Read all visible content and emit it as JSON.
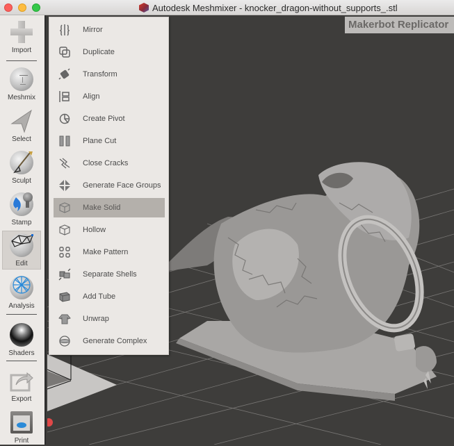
{
  "window": {
    "title": "Autodesk Meshmixer - knocker_dragon-without_supports_.stl",
    "app_icon": "meshmixer-logo-icon"
  },
  "sidebar": {
    "tools": [
      {
        "id": "import",
        "label": "Import",
        "icon": "plus-icon"
      },
      {
        "id": "meshmix",
        "label": "Meshmix",
        "icon": "face-sphere-icon"
      },
      {
        "id": "select",
        "label": "Select",
        "icon": "arrow-cursor-icon"
      },
      {
        "id": "sculpt",
        "label": "Sculpt",
        "icon": "brush-sphere-icon"
      },
      {
        "id": "stamp",
        "label": "Stamp",
        "icon": "stamp-sphere-icon"
      },
      {
        "id": "edit",
        "label": "Edit",
        "icon": "mesh-sphere-icon",
        "active": true
      },
      {
        "id": "analysis",
        "label": "Analysis",
        "icon": "lattice-sphere-icon"
      },
      {
        "id": "shaders",
        "label": "Shaders",
        "icon": "chrome-sphere-icon"
      },
      {
        "id": "export",
        "label": "Export",
        "icon": "export-arrow-icon"
      },
      {
        "id": "print",
        "label": "Print",
        "icon": "printer-icon"
      }
    ]
  },
  "viewport": {
    "printer_label": "Makerbot Replicator",
    "model_name": "knocker_dragon-without_supports_.stl"
  },
  "edit_menu": {
    "items": [
      {
        "label": "Mirror",
        "icon": "mirror-icon"
      },
      {
        "label": "Duplicate",
        "icon": "duplicate-icon"
      },
      {
        "label": "Transform",
        "icon": "transform-icon"
      },
      {
        "label": "Align",
        "icon": "align-icon"
      },
      {
        "label": "Create Pivot",
        "icon": "pivot-icon"
      },
      {
        "label": "Plane Cut",
        "icon": "plane-cut-icon"
      },
      {
        "label": "Close Cracks",
        "icon": "close-cracks-icon"
      },
      {
        "label": "Generate Face Groups",
        "icon": "face-groups-icon"
      },
      {
        "label": "Make Solid",
        "icon": "cube-icon",
        "selected": true
      },
      {
        "label": "Hollow",
        "icon": "hollow-cube-icon"
      },
      {
        "label": "Make Pattern",
        "icon": "pattern-grid-icon"
      },
      {
        "label": "Separate Shells",
        "icon": "separate-shells-icon"
      },
      {
        "label": "Add Tube",
        "icon": "tube-icon"
      },
      {
        "label": "Unwrap",
        "icon": "unwrap-shirt-icon"
      },
      {
        "label": "Generate Complex",
        "icon": "complex-sphere-icon"
      }
    ]
  },
  "colors": {
    "viewport_bg": "#3e3d3b",
    "menu_bg": "#ebe8e5",
    "menu_selected": "#b4b0ab",
    "axis_x": "#e04848"
  }
}
